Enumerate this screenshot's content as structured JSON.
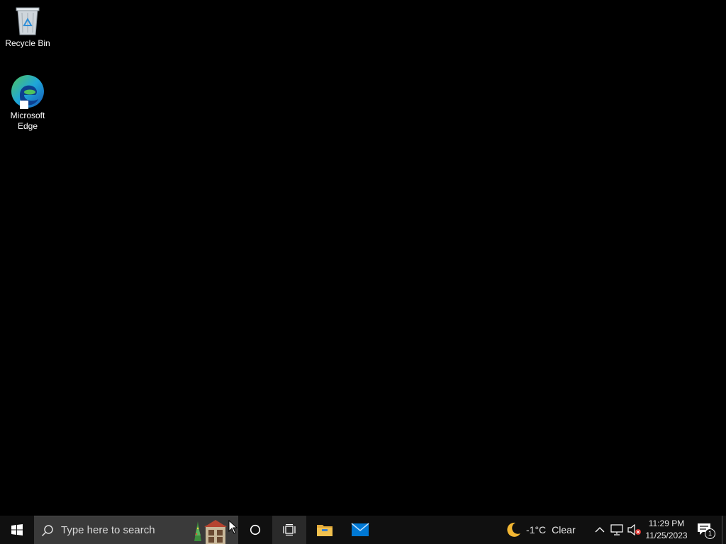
{
  "desktop": {
    "icons": [
      {
        "label": "Recycle Bin",
        "icon": "recycle-bin-icon"
      },
      {
        "label": "Microsoft Edge",
        "icon": "edge-icon"
      }
    ]
  },
  "taskbar": {
    "start_icon": "windows-logo-icon",
    "search": {
      "placeholder": "Type here to search"
    },
    "pinned": [
      "cortana-icon",
      "task-view-icon",
      "file-explorer-icon",
      "mail-icon"
    ],
    "weather": {
      "temp": "-1°C",
      "condition": "Clear",
      "icon": "moon-icon"
    },
    "tray": {
      "icons": [
        "chevron-up-icon",
        "network-icon",
        "volume-muted-icon"
      ],
      "time": "11:29 PM",
      "date": "11/25/2023",
      "notification_count": "1"
    }
  },
  "colors": {
    "desktop_bg": "#000000",
    "taskbar_bg": "#101010",
    "search_bg": "#3a3a3a",
    "edge_blue": "#1b7fd6",
    "edge_green": "#4fc35c",
    "folder_yellow": "#f2c14e",
    "mail_blue": "#0078d4"
  }
}
